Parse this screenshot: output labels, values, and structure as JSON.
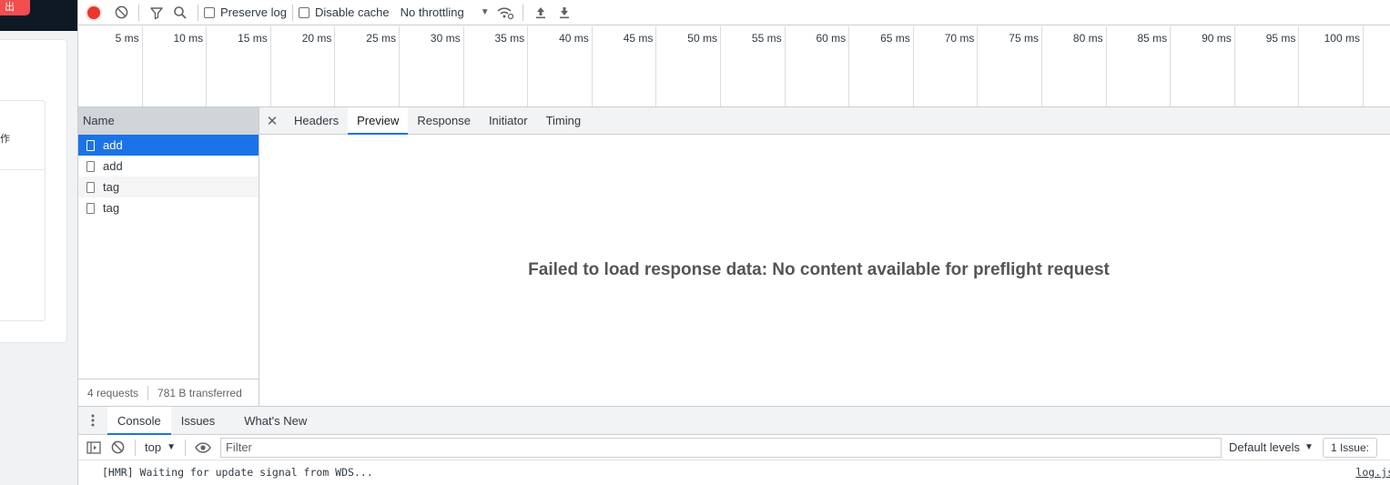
{
  "page": {
    "left_button_label": "出",
    "fragment_char": "作"
  },
  "toolbar": {
    "preserve_log": "Preserve log",
    "disable_cache": "Disable cache",
    "throttling": "No throttling"
  },
  "timeline": {
    "ticks": [
      "5 ms",
      "10 ms",
      "15 ms",
      "20 ms",
      "25 ms",
      "30 ms",
      "35 ms",
      "40 ms",
      "45 ms",
      "50 ms",
      "55 ms",
      "60 ms",
      "65 ms",
      "70 ms",
      "75 ms",
      "80 ms",
      "85 ms",
      "90 ms",
      "95 ms",
      "100 ms"
    ]
  },
  "requests": {
    "header": "Name",
    "items": [
      {
        "name": "add",
        "selected": true
      },
      {
        "name": "add",
        "selected": false
      },
      {
        "name": "tag",
        "selected": false
      },
      {
        "name": "tag",
        "selected": false
      }
    ],
    "footer": {
      "count": "4 requests",
      "transferred": "781 B transferred"
    }
  },
  "detail": {
    "tabs": [
      "Headers",
      "Preview",
      "Response",
      "Initiator",
      "Timing"
    ],
    "active_tab": "Preview",
    "message": "Failed to load response data: No content available for preflight request"
  },
  "drawer": {
    "tabs": [
      "Console",
      "Issues",
      "What's New"
    ],
    "active_tab": "Console",
    "context": "top",
    "filter_placeholder": "Filter",
    "levels": "Default levels",
    "issues": "1 Issue:",
    "log": {
      "text": "[HMR] Waiting for update signal from WDS...",
      "source": "log.js"
    }
  },
  "colors": {
    "accent": "#1a73e8",
    "record": "#e8372c"
  }
}
